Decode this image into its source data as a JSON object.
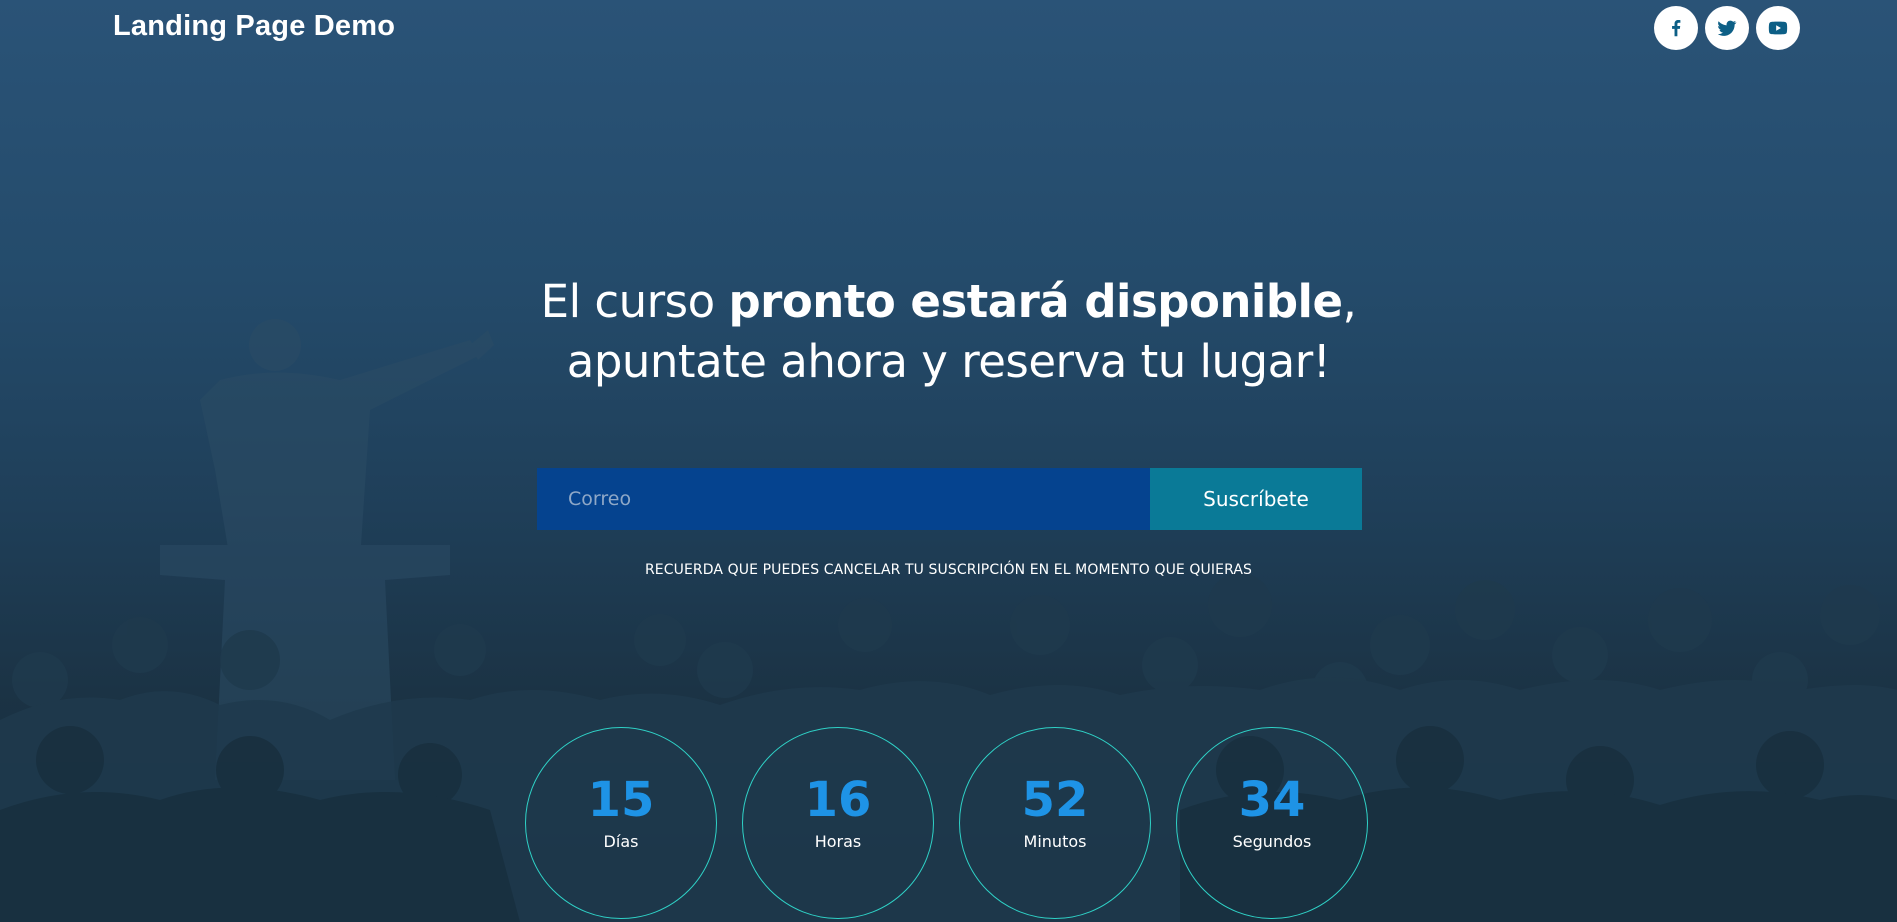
{
  "header": {
    "brand": "Landing Page Demo",
    "social": [
      {
        "icon": "facebook-icon",
        "label": "Facebook"
      },
      {
        "icon": "twitter-icon",
        "label": "Twitter"
      },
      {
        "icon": "youtube-icon",
        "label": "YouTube"
      }
    ]
  },
  "hero": {
    "line1_regular": "El curso ",
    "line1_bold": "pronto estará disponible",
    "line1_end": ",",
    "line2": "apuntate ahora y reserva tu lugar!"
  },
  "subscribe": {
    "placeholder": "Correo",
    "value": "",
    "button_label": "Suscríbete",
    "note": "RECUERDA QUE PUEDES CANCELAR TU SUSCRIPCIÓN EN EL MOMENTO QUE QUIERAS"
  },
  "countdown": [
    {
      "value": "15",
      "label": "Días"
    },
    {
      "value": "16",
      "label": "Horas"
    },
    {
      "value": "52",
      "label": "Minutos"
    },
    {
      "value": "34",
      "label": "Segundos"
    }
  ],
  "colors": {
    "background": "#244b6b",
    "input_bg": "#05438f",
    "button_bg": "#0a7a97",
    "countdown_number": "#1e93e6",
    "circle_border": "#2fd2c7"
  }
}
